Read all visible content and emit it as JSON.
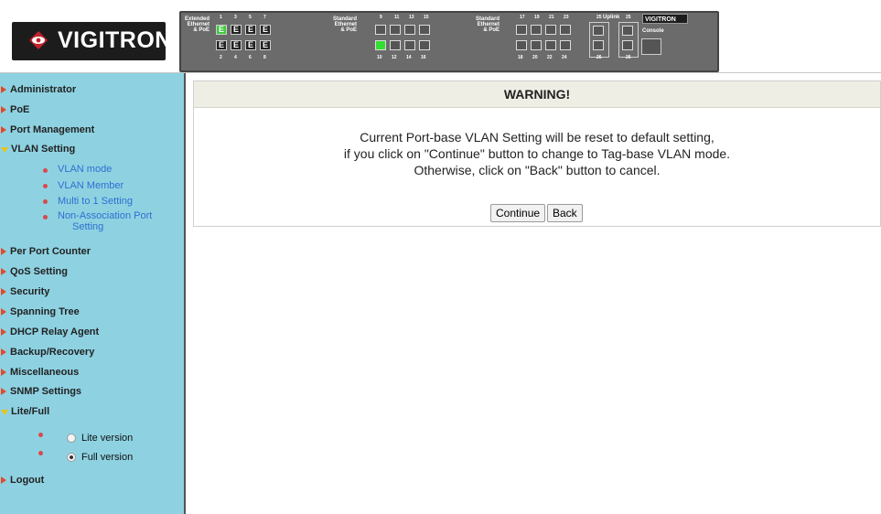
{
  "header": {
    "brand": "VIGITRON",
    "panel": {
      "brand_small": "VIGITRON",
      "group1_label": [
        "Extended",
        "Ethernet",
        "& PoE"
      ],
      "group2_label": [
        "Standard",
        "Ethernet",
        "& PoE"
      ],
      "group3_label": [
        "Standard",
        "Ethernet",
        "& PoE"
      ],
      "uplink_label": "Uplink",
      "console_label": "Console",
      "top_nums_g1": [
        "1",
        "3",
        "5",
        "7"
      ],
      "bottom_nums_g1": [
        "2",
        "4",
        "6",
        "8"
      ],
      "top_nums_g2": [
        "9",
        "11",
        "13",
        "15"
      ],
      "bottom_nums_g2": [
        "10",
        "12",
        "14",
        "16"
      ],
      "top_nums_g3": [
        "17",
        "19",
        "21",
        "23"
      ],
      "bottom_nums_g3": [
        "18",
        "20",
        "22",
        "24"
      ],
      "uplink_top": [
        "25",
        "25"
      ],
      "uplink_bottom": [
        "26",
        "26"
      ]
    }
  },
  "sidebar": {
    "items": [
      {
        "label": "Administrator"
      },
      {
        "label": "PoE"
      },
      {
        "label": "Port Management"
      },
      {
        "label": "VLAN Setting"
      },
      {
        "label": "Per Port Counter"
      },
      {
        "label": "QoS Setting"
      },
      {
        "label": "Security"
      },
      {
        "label": "Spanning Tree"
      },
      {
        "label": "DHCP Relay Agent"
      },
      {
        "label": "Backup/Recovery"
      },
      {
        "label": "Miscellaneous"
      },
      {
        "label": "SNMP Settings"
      },
      {
        "label": "Lite/Full"
      },
      {
        "label": "Logout"
      }
    ],
    "vlan_sub": [
      "VLAN mode",
      "VLAN Member",
      "Multi to 1 Setting",
      "Non-Association Port",
      "Setting"
    ],
    "lite_full": {
      "lite": "Lite version",
      "full": "Full version",
      "selected": "full"
    }
  },
  "main": {
    "title": "WARNING!",
    "line1": "Current Port-base VLAN Setting will be reset to default setting,",
    "line2": "if you click on \"Continue\" button to change to Tag-base VLAN mode.",
    "line3": "Otherwise, click on \"Back\" button to cancel.",
    "continue_label": "Continue",
    "back_label": "Back"
  }
}
